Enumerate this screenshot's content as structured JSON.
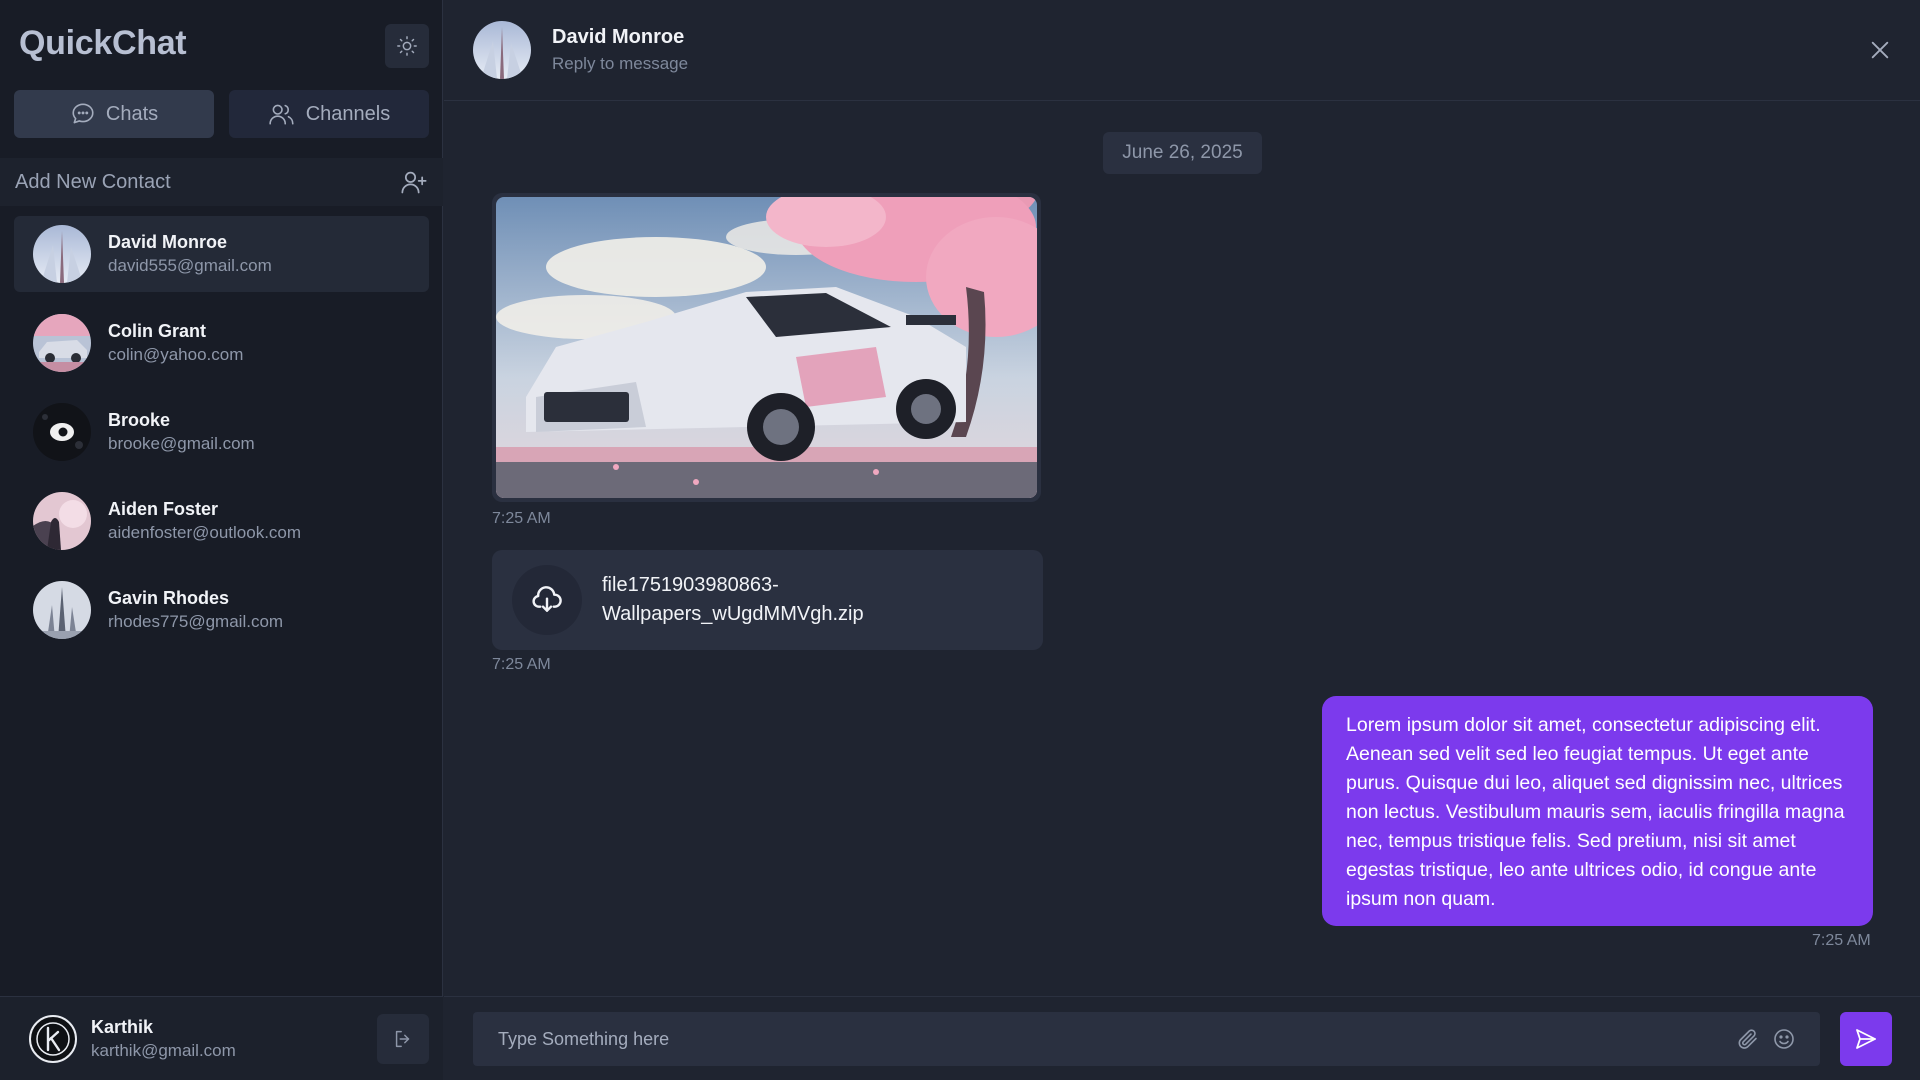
{
  "app": {
    "title": "QuickChat"
  },
  "tabs": [
    {
      "label": "Chats",
      "icon": "chat-bubble-icon",
      "active": true
    },
    {
      "label": "Channels",
      "icon": "users-icon",
      "active": false
    }
  ],
  "add_contact": {
    "label": "Add New Contact",
    "icon": "user-plus-icon"
  },
  "contacts": [
    {
      "name": "David Monroe",
      "email": "david555@gmail.com",
      "active": true
    },
    {
      "name": "Colin Grant",
      "email": "colin@yahoo.com",
      "active": false
    },
    {
      "name": "Brooke",
      "email": "brooke@gmail.com",
      "active": false
    },
    {
      "name": "Aiden Foster",
      "email": "aidenfoster@outlook.com",
      "active": false
    },
    {
      "name": "Gavin Rhodes",
      "email": "rhodes775@gmail.com",
      "active": false
    }
  ],
  "current_user": {
    "name": "Karthik",
    "email": "karthik@gmail.com",
    "avatar_letter": "k"
  },
  "chat": {
    "name": "David Monroe",
    "subtitle": "Reply to message",
    "date": "June 26, 2025",
    "messages": [
      {
        "type": "image",
        "time": "7:25 AM"
      },
      {
        "type": "file",
        "filename_line1": "file1751903980863-",
        "filename_line2": "Wallpapers_wUgdMMVgh.zip",
        "time": "7:25 AM"
      },
      {
        "type": "text",
        "direction": "outgoing",
        "text": "Lorem ipsum dolor sit amet, consectetur adipiscing elit. Aenean sed velit sed leo feugiat tempus. Ut eget ante purus. Quisque dui leo, aliquet sed dignissim nec, ultrices non lectus. Vestibulum mauris sem, iaculis fringilla magna nec, tempus tristique felis. Sed pretium, nisi sit amet egestas tristique, leo ante ultrices odio, id congue ante ipsum non quam.",
        "time": "7:25 AM"
      }
    ]
  },
  "composer": {
    "placeholder": "Type Something here"
  },
  "colors": {
    "accent": "#7c3aed",
    "sidebar_bg": "#181c26",
    "main_bg": "#1f2430"
  }
}
